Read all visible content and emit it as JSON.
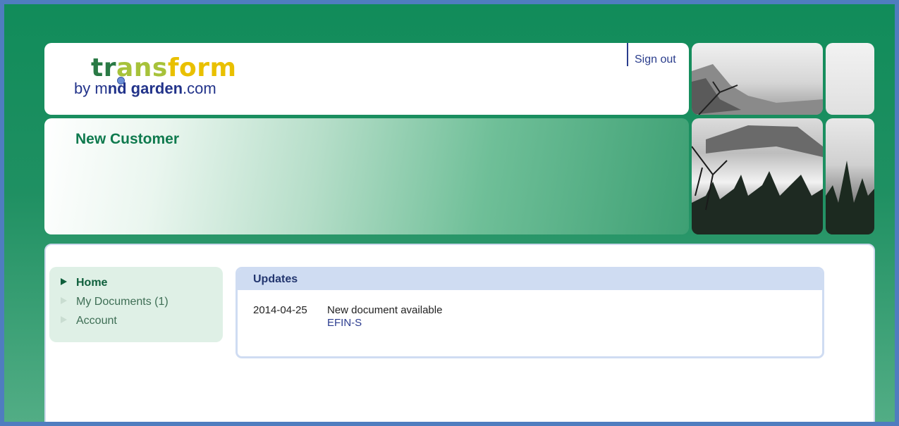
{
  "header": {
    "logo": {
      "word_part1": "tr",
      "word_part2": "ans",
      "word_part3": "form",
      "by_text": "by m",
      "mid_text": "nd garden",
      "com_text": ".com"
    },
    "sign_out_label": "Sign out"
  },
  "banner": {
    "title": "New Customer"
  },
  "nav": {
    "items": [
      {
        "label": "Home",
        "active": true
      },
      {
        "label": "My Documents (1)",
        "active": false
      },
      {
        "label": "Account",
        "active": false
      }
    ]
  },
  "updates": {
    "title": "Updates",
    "entries": [
      {
        "date": "2014-04-25",
        "text": "New document available",
        "link": "EFIN-S"
      }
    ]
  },
  "colors": {
    "background_green": "#118c5a",
    "frame_blue": "#4f7dbf",
    "accent_green": "#0f7a4e",
    "link_blue": "#2b3c8f"
  },
  "icons": {
    "nav_arrow": "triangle-right-icon"
  }
}
